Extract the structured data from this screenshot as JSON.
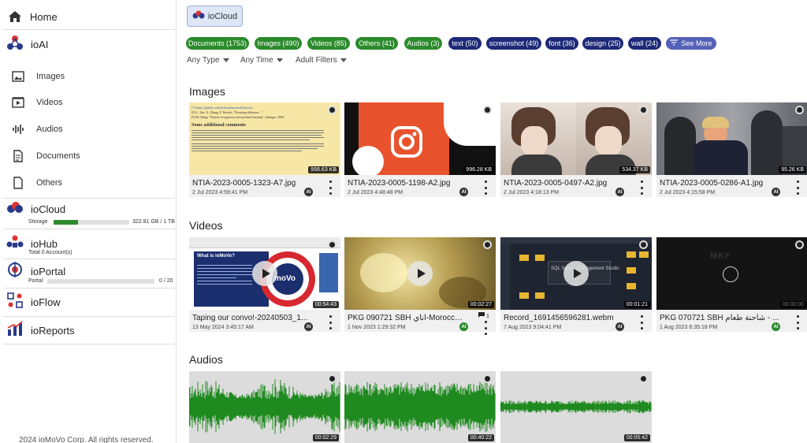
{
  "sidebar": {
    "home": "Home",
    "ioai": "ioAI",
    "sub_items": [
      {
        "label": "Images",
        "icon": "images-icon"
      },
      {
        "label": "Videos",
        "icon": "videos-icon"
      },
      {
        "label": "Audios",
        "icon": "audios-icon"
      },
      {
        "label": "Documents",
        "icon": "documents-icon"
      },
      {
        "label": "Others",
        "icon": "others-icon"
      }
    ],
    "iocloud": {
      "label": "ioCloud",
      "storage_label": "Storage",
      "storage_value": "322.81 GB / 1 TB",
      "storage_fraction": 0.32
    },
    "iohub": {
      "label": "ioHub",
      "sub": "Total 0 Account(s)"
    },
    "ioportal": {
      "label": "ioPortal",
      "sub": "Portal",
      "count": "0 / 20"
    },
    "ioflow": {
      "label": "ioFlow"
    },
    "ioreports": {
      "label": "ioReports"
    },
    "footer": "2024 ioMoVo Corp. All rights reserved."
  },
  "toolbar": {
    "iocloud_button": "ioCloud"
  },
  "chips": [
    {
      "label": "Documents (1753)",
      "color": "#2b8a2b"
    },
    {
      "label": "Images (490)",
      "color": "#2b8a2b"
    },
    {
      "label": "Videos (85)",
      "color": "#2b8a2b"
    },
    {
      "label": "Others (41)",
      "color": "#2b8a2b"
    },
    {
      "label": "Audios (3)",
      "color": "#2b8a2b"
    },
    {
      "label": "text (50)",
      "color": "#1e2a78"
    },
    {
      "label": "screenshot (49)",
      "color": "#1e2a78"
    },
    {
      "label": "font (36)",
      "color": "#1e2a78"
    },
    {
      "label": "design (25)",
      "color": "#1e2a78"
    },
    {
      "label": "wall (24)",
      "color": "#1e2a78"
    },
    {
      "label": "See More",
      "color": "#5561b8"
    }
  ],
  "filters": [
    "Any Type",
    "Any Time",
    "Adult Filters"
  ],
  "sections": {
    "images": "Images",
    "videos": "Videos",
    "audios": "Audios"
  },
  "images": [
    {
      "name": "NTIA-2023-0005-1323-A7.jpg",
      "date": "2 Jul 2023 4:59:41 PM",
      "size": "956.63 KB",
      "ai": "AI"
    },
    {
      "name": "NTIA-2023-0005-1198-A2.jpg",
      "date": "2 Jul 2023 4:48:48 PM",
      "size": "996.28 KB",
      "ai": "AI"
    },
    {
      "name": "NTIA-2023-0005-0497-A2.jpg",
      "date": "2 Jul 2023 4:18:13 PM",
      "size": "534.37 KB",
      "ai": "AI"
    },
    {
      "name": "NTIA-2023-0005-0286-A1.jpg",
      "date": "2 Jul 2023 4:15:58 PM",
      "size": "95.26 KB",
      "ai": "AI"
    }
  ],
  "image1_doc": {
    "lines": [
      "[7] https://github.com/facebookresearch/fairseq/...",
      "[8] L. Jiao, X. Zhang, P. Ilievski, \"Boosting diffusion ...\"",
      "[9] M. Wang, \"Pattern recognition and machine learning\", Springer, 2006"
    ],
    "heading": "Some additional comments"
  },
  "videos": [
    {
      "name": "Taping our convo!-20240503_1...",
      "date": "13 May 2024 3:45:17 AM",
      "duration": "00:54:43",
      "ai": "AI",
      "ai_color": "#333",
      "slide_title": "What is ioMoVo?",
      "logo": "moVo"
    },
    {
      "name": "PKG 090721 SBH أناي-Morocco ...",
      "date": "1 Nov 2023 1:29:32 PM",
      "duration": "00:02:27",
      "ai": "AI",
      "ai_color": "#2b8a2b",
      "comments": "1"
    },
    {
      "name": "Record_1691456596281.webm",
      "date": "7 Aug 2023 9:04:41 PM",
      "duration": "00:01:21",
      "ai": "AI",
      "ai_color": "#333",
      "overlay_text": "SQL Server Management Studio"
    },
    {
      "name": "PKG 070721 SBH شاحنة طعام - ...",
      "date": "1 Aug 2023 6:35:18 PM",
      "duration": "00:00:00",
      "ai": "AI",
      "ai_color": "#2b8a2b",
      "watermark": "MKF"
    }
  ],
  "audios": [
    {
      "duration": "00:02:29"
    },
    {
      "duration": "00:40:22"
    },
    {
      "duration": "00:05:42"
    }
  ]
}
